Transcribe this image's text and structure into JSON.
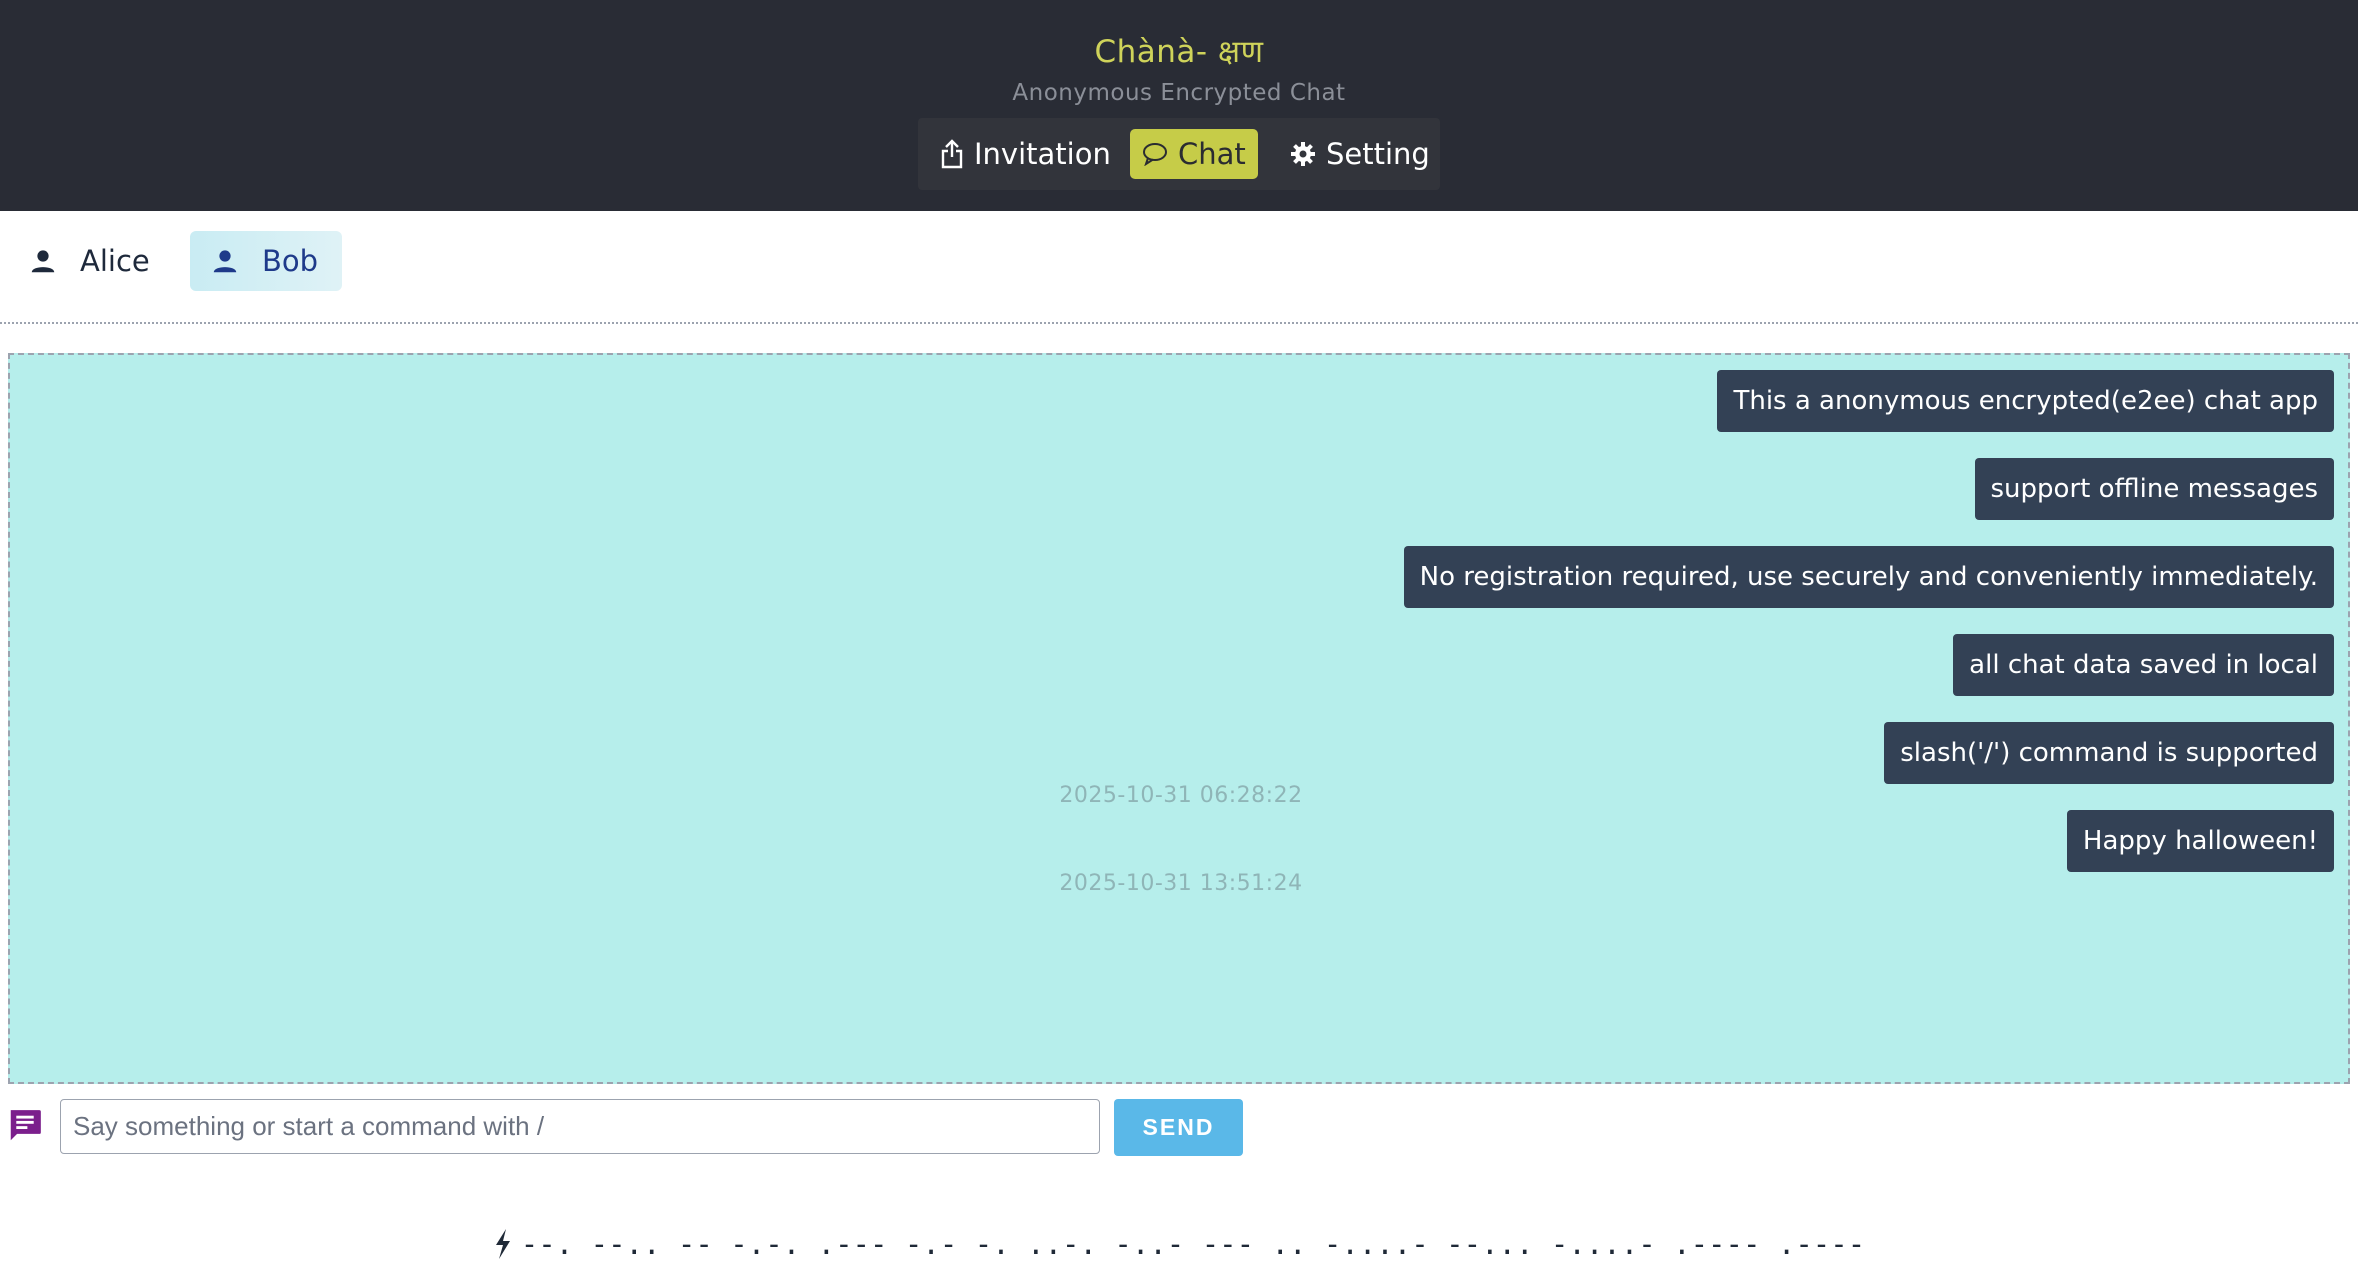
{
  "app": {
    "title": "Chànà- क्षण",
    "subtitle": "Anonymous Encrypted Chat"
  },
  "nav": {
    "tabs": [
      {
        "label": "Invitation",
        "icon": "share-icon",
        "active": false
      },
      {
        "label": "Chat",
        "icon": "chat-bubble-icon",
        "active": true
      },
      {
        "label": "Setting",
        "icon": "gear-icon",
        "active": false
      }
    ]
  },
  "contacts": [
    {
      "name": "Alice",
      "icon": "person-icon",
      "selected": false
    },
    {
      "name": "Bob",
      "icon": "person-icon",
      "selected": true
    }
  ],
  "messages": [
    {
      "text": "This a anonymous encrypted(e2ee) chat app"
    },
    {
      "text": "support offline messages"
    },
    {
      "text": "No registration required, use securely and conveniently immediately."
    },
    {
      "text": "all chat data saved in local"
    },
    {
      "text": "slash('/') command is supported"
    },
    {
      "text": "Happy halloween!"
    }
  ],
  "timestamps": [
    "2025-10-31 06:28:22",
    "2025-10-31 13:51:24"
  ],
  "composer": {
    "placeholder": "Say something or start a command with /",
    "value": "",
    "send_label": "SEND",
    "icon": "message-icon"
  },
  "footer": {
    "icon": "lightning-icon",
    "text": "--. --.. -- -.-. .--- -.- -. ..-. -..- --- .. -....- --... -....- .---- .----"
  },
  "colors": {
    "header_bg": "#292c35",
    "title": "#cfd35a",
    "active_tab": "#c6cc48",
    "chat_bg": "#b6eeeb",
    "bubble_bg": "#334155",
    "send_button": "#5ab8e8",
    "composer_icon": "#7b1f8c"
  }
}
